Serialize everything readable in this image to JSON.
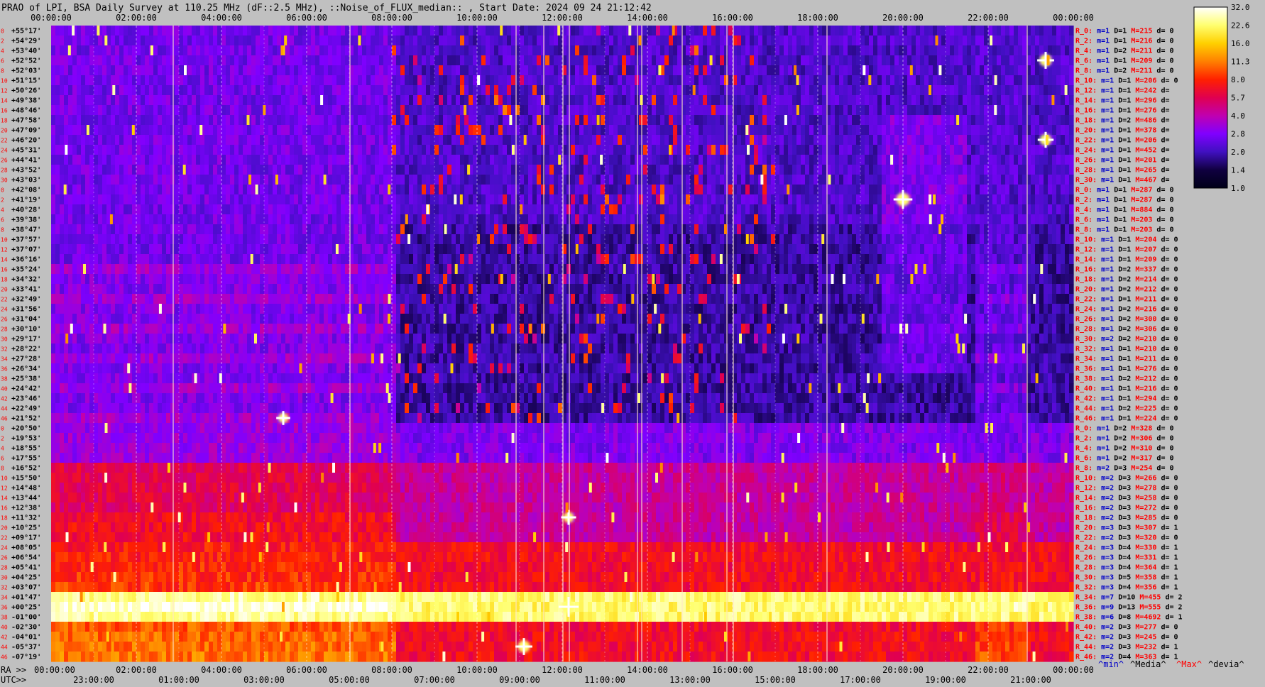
{
  "chart_data": {
    "type": "heatmap",
    "title": "PRAO of LPI, BSA Daily Survey at 110.25 MHz (dF::2.5 MHz), ::Noise_of_FLUX_median:: , Start Date: 2024 09 24 21:12:42",
    "top_axis_ticks": [
      "00:00:00",
      "02:00:00",
      "04:00:00",
      "06:00:00",
      "08:00:00",
      "10:00:00",
      "12:00:00",
      "14:00:00",
      "16:00:00",
      "18:00:00",
      "20:00:00",
      "22:00:00",
      "00:00:00"
    ],
    "ra_axis_label": "RA >>",
    "ra_axis_ticks": [
      "00:00:00",
      "02:00:00",
      "04:00:00",
      "06:00:00",
      "08:00:00",
      "10:00:00",
      "12:00:00",
      "14:00:00",
      "16:00:00",
      "18:00:00",
      "20:00:00",
      "22:00:00",
      "00:00:00"
    ],
    "utc_axis_label": "UTC>>",
    "utc_axis_ticks": [
      "23:00:00",
      "01:00:00",
      "03:00:00",
      "05:00:00",
      "07:00:00",
      "09:00:00",
      "11:00:00",
      "13:00:00",
      "15:00:00",
      "17:00:00",
      "19:00:00",
      "21:00:00"
    ],
    "rows": [
      {
        "idx": "0",
        "dec": "+55°17'",
        "ray": "R_0:",
        "m": "m=1",
        "D": "D=1",
        "M": "M=215",
        "d": "d= 0"
      },
      {
        "idx": "2",
        "dec": "+54°29'",
        "ray": "R_2:",
        "m": "m=1",
        "D": "D=1",
        "M": "M=216",
        "d": "d= 0"
      },
      {
        "idx": "4",
        "dec": "+53°40'",
        "ray": "R_4:",
        "m": "m=1",
        "D": "D=2",
        "M": "M=211",
        "d": "d= 0"
      },
      {
        "idx": "6",
        "dec": "+52°52'",
        "ray": "R_6:",
        "m": "m=1",
        "D": "D=1",
        "M": "M=209",
        "d": "d= 0"
      },
      {
        "idx": "8",
        "dec": "+52°03'",
        "ray": "R_8:",
        "m": "m=1",
        "D": "D=2",
        "M": "M=211",
        "d": "d= 0"
      },
      {
        "idx": "10",
        "dec": "+51°15'",
        "ray": "R_10:",
        "m": "m=1",
        "D": "D=1",
        "M": "M=206",
        "d": "d= 0"
      },
      {
        "idx": "12",
        "dec": "+50°26'",
        "ray": "R_12:",
        "m": "m=1",
        "D": "D=1",
        "M": "M=242",
        "d": "d="
      },
      {
        "idx": "14",
        "dec": "+49°38'",
        "ray": "R_14:",
        "m": "m=1",
        "D": "D=1",
        "M": "M=296",
        "d": "d="
      },
      {
        "idx": "16",
        "dec": "+48°46'",
        "ray": "R_16:",
        "m": "m=1",
        "D": "D=1",
        "M": "M=276",
        "d": "d="
      },
      {
        "idx": "18",
        "dec": "+47°58'",
        "ray": "R_18:",
        "m": "m=1",
        "D": "D=2",
        "M": "M=486",
        "d": "d="
      },
      {
        "idx": "20",
        "dec": "+47°09'",
        "ray": "R_20:",
        "m": "m=1",
        "D": "D=1",
        "M": "M=378",
        "d": "d="
      },
      {
        "idx": "22",
        "dec": "+46°20'",
        "ray": "R_22:",
        "m": "m=1",
        "D": "D=1",
        "M": "M=206",
        "d": "d="
      },
      {
        "idx": "24",
        "dec": "+45°31'",
        "ray": "R_24:",
        "m": "m=1",
        "D": "D=1",
        "M": "M=452",
        "d": "d="
      },
      {
        "idx": "26",
        "dec": "+44°41'",
        "ray": "R_26:",
        "m": "m=1",
        "D": "D=1",
        "M": "M=201",
        "d": "d="
      },
      {
        "idx": "28",
        "dec": "+43°52'",
        "ray": "R_28:",
        "m": "m=1",
        "D": "D=1",
        "M": "M=265",
        "d": "d="
      },
      {
        "idx": "30",
        "dec": "+43°03'",
        "ray": "R_30:",
        "m": "m=1",
        "D": "D=1",
        "M": "M=467",
        "d": "d="
      },
      {
        "idx": "0",
        "dec": "+42°08'",
        "ray": "R_0:",
        "m": "m=1",
        "D": "D=1",
        "M": "M=287",
        "d": "d= 0"
      },
      {
        "idx": "2",
        "dec": "+41°19'",
        "ray": "R_2:",
        "m": "m=1",
        "D": "D=1",
        "M": "M=287",
        "d": "d= 0"
      },
      {
        "idx": "4",
        "dec": "+40°28'",
        "ray": "R_4:",
        "m": "m=1",
        "D": "D=1",
        "M": "M=884",
        "d": "d= 0"
      },
      {
        "idx": "6",
        "dec": "+39°38'",
        "ray": "R_6:",
        "m": "m=1",
        "D": "D=1",
        "M": "M=203",
        "d": "d= 0"
      },
      {
        "idx": "8",
        "dec": "+38°47'",
        "ray": "R_8:",
        "m": "m=1",
        "D": "D=1",
        "M": "M=203",
        "d": "d= 0"
      },
      {
        "idx": "10",
        "dec": "+37°57'",
        "ray": "R_10:",
        "m": "m=1",
        "D": "D=1",
        "M": "M=204",
        "d": "d= 0"
      },
      {
        "idx": "12",
        "dec": "+37°07'",
        "ray": "R_12:",
        "m": "m=1",
        "D": "D=1",
        "M": "M=207",
        "d": "d= 0"
      },
      {
        "idx": "14",
        "dec": "+36°16'",
        "ray": "R_14:",
        "m": "m=1",
        "D": "D=1",
        "M": "M=209",
        "d": "d= 0"
      },
      {
        "idx": "16",
        "dec": "+35°24'",
        "ray": "R_16:",
        "m": "m=1",
        "D": "D=2",
        "M": "M=337",
        "d": "d= 0"
      },
      {
        "idx": "18",
        "dec": "+34°32'",
        "ray": "R_18:",
        "m": "m=1",
        "D": "D=2",
        "M": "M=214",
        "d": "d= 0"
      },
      {
        "idx": "20",
        "dec": "+33°41'",
        "ray": "R_20:",
        "m": "m=1",
        "D": "D=2",
        "M": "M=212",
        "d": "d= 0"
      },
      {
        "idx": "22",
        "dec": "+32°49'",
        "ray": "R_22:",
        "m": "m=1",
        "D": "D=1",
        "M": "M=211",
        "d": "d= 0"
      },
      {
        "idx": "24",
        "dec": "+31°56'",
        "ray": "R_24:",
        "m": "m=1",
        "D": "D=2",
        "M": "M=216",
        "d": "d= 0"
      },
      {
        "idx": "26",
        "dec": "+31°04'",
        "ray": "R_26:",
        "m": "m=1",
        "D": "D=2",
        "M": "M=300",
        "d": "d= 0"
      },
      {
        "idx": "28",
        "dec": "+30°10'",
        "ray": "R_28:",
        "m": "m=1",
        "D": "D=2",
        "M": "M=306",
        "d": "d= 0"
      },
      {
        "idx": "30",
        "dec": "+29°17'",
        "ray": "R_30:",
        "m": "m=2",
        "D": "D=2",
        "M": "M=210",
        "d": "d= 0"
      },
      {
        "idx": "32",
        "dec": "+28°22'",
        "ray": "R_32:",
        "m": "m=1",
        "D": "D=1",
        "M": "M=210",
        "d": "d= 0"
      },
      {
        "idx": "34",
        "dec": "+27°28'",
        "ray": "R_34:",
        "m": "m=1",
        "D": "D=1",
        "M": "M=211",
        "d": "d= 0"
      },
      {
        "idx": "36",
        "dec": "+26°34'",
        "ray": "R_36:",
        "m": "m=1",
        "D": "D=1",
        "M": "M=276",
        "d": "d= 0"
      },
      {
        "idx": "38",
        "dec": "+25°38'",
        "ray": "R_38:",
        "m": "m=1",
        "D": "D=2",
        "M": "M=212",
        "d": "d= 0"
      },
      {
        "idx": "40",
        "dec": "+24°42'",
        "ray": "R_40:",
        "m": "m=1",
        "D": "D=1",
        "M": "M=216",
        "d": "d= 0"
      },
      {
        "idx": "42",
        "dec": "+23°46'",
        "ray": "R_42:",
        "m": "m=1",
        "D": "D=1",
        "M": "M=294",
        "d": "d= 0"
      },
      {
        "idx": "44",
        "dec": "+22°49'",
        "ray": "R_44:",
        "m": "m=1",
        "D": "D=2",
        "M": "M=225",
        "d": "d= 0"
      },
      {
        "idx": "46",
        "dec": "+21°52'",
        "ray": "R_46:",
        "m": "m=1",
        "D": "D=1",
        "M": "M=224",
        "d": "d= 0"
      },
      {
        "idx": "0",
        "dec": "+20°50'",
        "ray": "R_0:",
        "m": "m=1",
        "D": "D=2",
        "M": "M=328",
        "d": "d= 0"
      },
      {
        "idx": "2",
        "dec": "+19°53'",
        "ray": "R_2:",
        "m": "m=1",
        "D": "D=2",
        "M": "M=306",
        "d": "d= 0"
      },
      {
        "idx": "4",
        "dec": "+18°55'",
        "ray": "R_4:",
        "m": "m=1",
        "D": "D=2",
        "M": "M=310",
        "d": "d= 0"
      },
      {
        "idx": "6",
        "dec": "+17°55'",
        "ray": "R_6:",
        "m": "m=1",
        "D": "D=2",
        "M": "M=317",
        "d": "d= 0"
      },
      {
        "idx": "8",
        "dec": "+16°52'",
        "ray": "R_8:",
        "m": "m=2",
        "D": "D=3",
        "M": "M=254",
        "d": "d= 0"
      },
      {
        "idx": "10",
        "dec": "+15°50'",
        "ray": "R_10:",
        "m": "m=2",
        "D": "D=3",
        "M": "M=266",
        "d": "d= 0"
      },
      {
        "idx": "12",
        "dec": "+14°48'",
        "ray": "R_12:",
        "m": "m=2",
        "D": "D=3",
        "M": "M=278",
        "d": "d= 0"
      },
      {
        "idx": "14",
        "dec": "+13°44'",
        "ray": "R_14:",
        "m": "m=2",
        "D": "D=3",
        "M": "M=258",
        "d": "d= 0"
      },
      {
        "idx": "16",
        "dec": "+12°38'",
        "ray": "R_16:",
        "m": "m=2",
        "D": "D=3",
        "M": "M=272",
        "d": "d= 0"
      },
      {
        "idx": "18",
        "dec": "+11°32'",
        "ray": "R_18:",
        "m": "m=2",
        "D": "D=3",
        "M": "M=285",
        "d": "d= 0"
      },
      {
        "idx": "20",
        "dec": "+10°25'",
        "ray": "R_20:",
        "m": "m=3",
        "D": "D=3",
        "M": "M=307",
        "d": "d= 1"
      },
      {
        "idx": "22",
        "dec": "+09°17'",
        "ray": "R_22:",
        "m": "m=2",
        "D": "D=3",
        "M": "M=320",
        "d": "d= 0"
      },
      {
        "idx": "24",
        "dec": "+08°05'",
        "ray": "R_24:",
        "m": "m=3",
        "D": "D=4",
        "M": "M=330",
        "d": "d= 1"
      },
      {
        "idx": "26",
        "dec": "+06°54'",
        "ray": "R_26:",
        "m": "m=3",
        "D": "D=4",
        "M": "M=331",
        "d": "d= 1"
      },
      {
        "idx": "28",
        "dec": "+05°41'",
        "ray": "R_28:",
        "m": "m=3",
        "D": "D=4",
        "M": "M=364",
        "d": "d= 1"
      },
      {
        "idx": "30",
        "dec": "+04°25'",
        "ray": "R_30:",
        "m": "m=3",
        "D": "D=5",
        "M": "M=358",
        "d": "d= 1"
      },
      {
        "idx": "32",
        "dec": "+03°07'",
        "ray": "R_32:",
        "m": "m=3",
        "D": "D=4",
        "M": "M=356",
        "d": "d= 1"
      },
      {
        "idx": "34",
        "dec": "+01°47'",
        "ray": "R_34:",
        "m": "m=7",
        "D": "D=10",
        "M": "M=455",
        "d": "d= 2"
      },
      {
        "idx": "36",
        "dec": "+00°25'",
        "ray": "R_36:",
        "m": "m=9",
        "D": "D=13",
        "M": "M=555",
        "d": "d= 2"
      },
      {
        "idx": "38",
        "dec": "-01°00'",
        "ray": "R_38:",
        "m": "m=6",
        "D": "D=8",
        "M": "M=4692",
        "d": "d= 1"
      },
      {
        "idx": "40",
        "dec": "-02°30'",
        "ray": "R_40:",
        "m": "m=2",
        "D": "D=3",
        "M": "M=277",
        "d": "d= 0"
      },
      {
        "idx": "42",
        "dec": "-04°01'",
        "ray": "R_42:",
        "m": "m=2",
        "D": "D=3",
        "M": "M=245",
        "d": "d= 0"
      },
      {
        "idx": "44",
        "dec": "-05°37'",
        "ray": "R_44:",
        "m": "m=2",
        "D": "D=3",
        "M": "M=232",
        "d": "d= 1"
      },
      {
        "idx": "46",
        "dec": "-07°19'",
        "ray": "R_46:",
        "m": "m=2",
        "D": "D=4",
        "M": "M=363",
        "d": "d= 1"
      }
    ],
    "colorbar": {
      "ticks": [
        "32.0",
        "22.6",
        "16.0",
        "11.3",
        "8.0",
        "5.7",
        "4.0",
        "2.8",
        "2.0",
        "1.4",
        "1.0"
      ],
      "stops": [
        "#ffffff",
        "#ffff70",
        "#ffd000",
        "#ff8000",
        "#ff2000",
        "#e00050",
        "#c000b0",
        "#8000ff",
        "#4010c0",
        "#100040",
        "#000018"
      ]
    },
    "legend": {
      "min": "^min^",
      "median": "^Media^",
      "max": "^Max^",
      "devia": "^devia^"
    },
    "bright_features": [
      {
        "x_hours": 12.15,
        "row": 58,
        "intensity": 1.0
      },
      {
        "x_hours": 20.0,
        "row": 17,
        "intensity": 0.95
      },
      {
        "x_hours": 23.35,
        "row": 3,
        "intensity": 0.85
      },
      {
        "x_hours": 23.35,
        "row": 11,
        "intensity": 0.8
      },
      {
        "x_hours": 11.1,
        "row": 62,
        "intensity": 0.85
      },
      {
        "x_hours": 12.15,
        "row": 49,
        "intensity": 0.75
      },
      {
        "x_hours": 5.45,
        "row": 39,
        "intensity": 0.7
      }
    ]
  },
  "colors": {
    "background": "#c0c0c0",
    "text": "#000000",
    "ray_label": "#ff0000",
    "m_label": "#0000c8",
    "D_label": "#000000",
    "M_label": "#ff0000",
    "d_label": "#000000",
    "index_label": "#ff0000",
    "dec_label": "#000000"
  }
}
